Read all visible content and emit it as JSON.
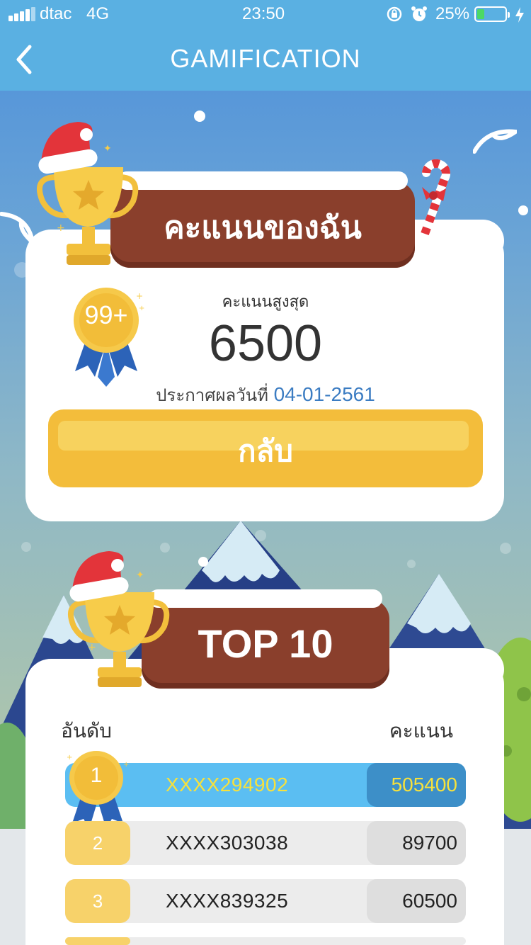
{
  "status_bar": {
    "carrier": "dtac",
    "network": "4G",
    "time": "23:50",
    "battery_percent_label": "25%",
    "battery_level": 0.25,
    "battery_color": "#4cd964"
  },
  "nav": {
    "back_icon": "chevron-left-icon",
    "title": "GAMIFICATION",
    "bar_color": "#5ab0e2"
  },
  "my_score": {
    "header": "คะแนนของฉัน",
    "badge_text": "99+",
    "label": "คะแนนสูงสุด",
    "value": "6500",
    "announce_label": "ประกาศผลวันที่",
    "announce_date": "04-01-2561",
    "back_button_label": "กลับ",
    "button_color": "#f3bd3b"
  },
  "leaderboard": {
    "header": "TOP 10",
    "col_rank": "อันดับ",
    "col_score": "คะแนน",
    "rows": [
      {
        "rank": "1",
        "user": "XXXX294902",
        "score": "505400"
      },
      {
        "rank": "2",
        "user": "XXXX303038",
        "score": "89700"
      },
      {
        "rank": "3",
        "user": "XXXX839325",
        "score": "60500"
      }
    ]
  },
  "icons": [
    "trophy-icon",
    "santa-hat-icon",
    "candy-cane-icon",
    "medal-icon",
    "alarm-icon",
    "rotation-lock-icon",
    "charging-icon"
  ]
}
